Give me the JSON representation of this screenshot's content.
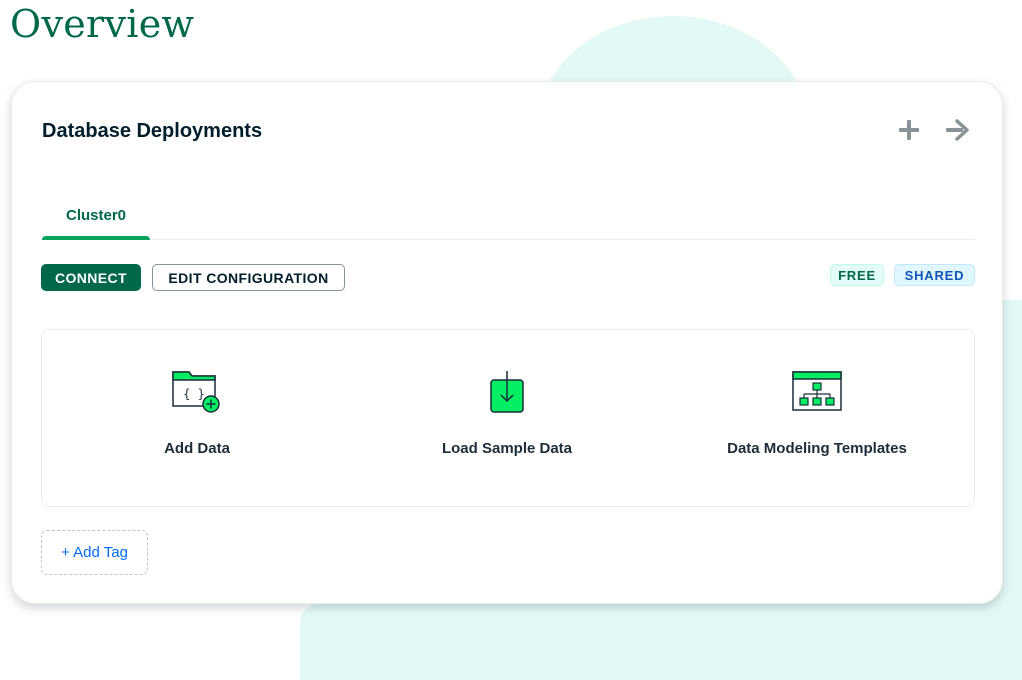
{
  "page": {
    "title": "Overview"
  },
  "card": {
    "title": "Database Deployments",
    "tabs": [
      {
        "label": "Cluster0",
        "active": true
      }
    ],
    "buttons": {
      "connect": "CONNECT",
      "edit": "EDIT CONFIGURATION"
    },
    "badges": {
      "free": "FREE",
      "shared": "SHARED"
    },
    "actions": [
      {
        "label": "Add Data",
        "icon": "add-data-icon"
      },
      {
        "label": "Load Sample Data",
        "icon": "load-sample-data-icon"
      },
      {
        "label": "Data Modeling Templates",
        "icon": "data-modeling-templates-icon"
      }
    ],
    "add_tag": "+ Add Tag"
  },
  "colors": {
    "brand_green": "#00684a",
    "accent_green": "#00ed64",
    "link_blue": "#016bf8",
    "icon_gray": "#889397"
  }
}
